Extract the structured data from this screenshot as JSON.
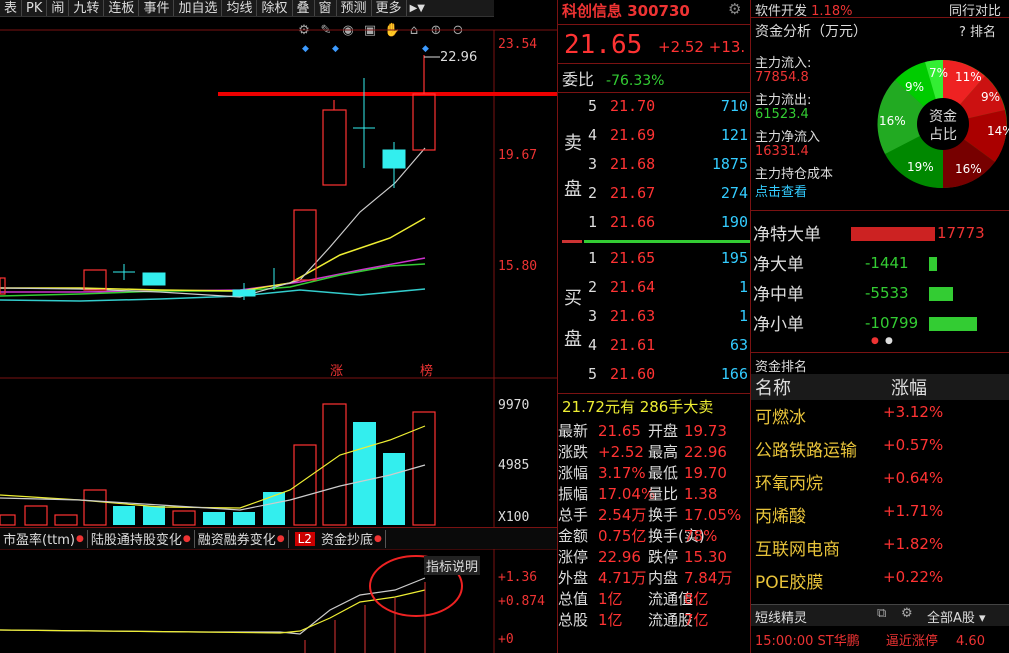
{
  "toolbar": {
    "items": [
      "表",
      "PK",
      "闹",
      "九转",
      "连板",
      "事件",
      "加自选",
      "均线",
      "除权",
      "叠",
      "窗",
      "预测",
      "更多"
    ]
  },
  "chart": {
    "price_axis": [
      "23.54",
      "19.67",
      "15.80"
    ],
    "annot_high": "22.96",
    "labels_zhang": "涨",
    "labels_bang": "榜",
    "vol_axis": [
      "9970",
      "4985",
      "X100"
    ],
    "ind_axis": [
      "+1.36",
      "+0.874",
      "+0"
    ],
    "ind_hint": "指标说明",
    "tabs": [
      "市盈率(ttm)",
      "陆股通持股变化",
      "融资融券变化"
    ],
    "tab_l2": "L2",
    "tab_last": "资金抄底"
  },
  "stock": {
    "name": "科创信息",
    "code": "300730",
    "price": "21.65",
    "change": "+2.52",
    "pct": "+13.",
    "weibi_label": "委比",
    "weibi": "-76.33%"
  },
  "book": {
    "sell_label": [
      "卖",
      "盘"
    ],
    "buy_label": [
      "买",
      "盘"
    ],
    "sell": [
      [
        "5",
        "21.70",
        "710"
      ],
      [
        "4",
        "21.69",
        "121"
      ],
      [
        "3",
        "21.68",
        "1875"
      ],
      [
        "2",
        "21.67",
        "274"
      ],
      [
        "1",
        "21.66",
        "190"
      ]
    ],
    "buy": [
      [
        "1",
        "21.65",
        "195"
      ],
      [
        "2",
        "21.64",
        "1"
      ],
      [
        "3",
        "21.63",
        "1"
      ],
      [
        "4",
        "21.61",
        "63"
      ],
      [
        "5",
        "21.60",
        "166"
      ]
    ],
    "big_sell": "21.72元有 286手大卖"
  },
  "quote": [
    [
      "最新",
      "21.65",
      "开盘",
      "19.73"
    ],
    [
      "涨跌",
      "+2.52",
      "最高",
      "22.96"
    ],
    [
      "涨幅",
      "3.17%",
      "最低",
      "19.70"
    ],
    [
      "振幅",
      "17.04%",
      "量比",
      "1.38"
    ],
    [
      "总手",
      "2.54万",
      "换手",
      "17.05%"
    ],
    [
      "金额",
      "0.75亿",
      "换手(实)",
      "78%"
    ],
    [
      "涨停",
      "22.96",
      "跌停",
      "15.30"
    ],
    [
      "外盘",
      "4.71万",
      "内盘",
      "7.84万"
    ],
    [
      "总值",
      "1亿",
      "流通值",
      "8亿"
    ],
    [
      "总股",
      "1亿",
      "流通股",
      "7亿"
    ]
  ],
  "right": {
    "top_left": "软件开发",
    "top_pct": "1.18%",
    "top_right": "同行对比",
    "fa_title": "资金分析（万元）",
    "fa_q": "?",
    "fa_rank": "排名",
    "fa_rows": [
      [
        "主力流入:",
        "77854.8",
        "#e33"
      ],
      [
        "主力流出:",
        "61523.4",
        "#3c3"
      ],
      [
        "主力净流入",
        "16331.4",
        "#e33"
      ],
      [
        "主力持仓成本",
        "点击查看",
        "#3cf"
      ]
    ],
    "pie_center": [
      "资金",
      "占比"
    ],
    "pie_labels": [
      "7%",
      "11%",
      "9%",
      "14%",
      "16%",
      "19%",
      "16%",
      "9%"
    ],
    "net": [
      [
        "净特大单",
        "17773",
        "#e33"
      ],
      [
        "净大单",
        "-1441",
        "#3c3"
      ],
      [
        "净中单",
        "-5533",
        "#3c3"
      ],
      [
        "净小单",
        "-10799",
        "#3c3"
      ]
    ],
    "rk_title": "资金排名",
    "rk_hdr": [
      "名称",
      "涨幅"
    ],
    "rk_rows": [
      [
        "可燃冰",
        "+3.12%"
      ],
      [
        "公路铁路运输",
        "+0.57%"
      ],
      [
        "环氧丙烷",
        "+0.64%"
      ],
      [
        "丙烯酸",
        "+1.71%"
      ],
      [
        "互联网电商",
        "+1.82%"
      ],
      [
        "POE胶膜",
        "+0.22%"
      ]
    ],
    "dx_title": "短线精灵",
    "dx_filter": "全部A股",
    "dx_row": [
      "15:00:00",
      "ST华鹏",
      "逼近涨停",
      "4.60"
    ]
  }
}
